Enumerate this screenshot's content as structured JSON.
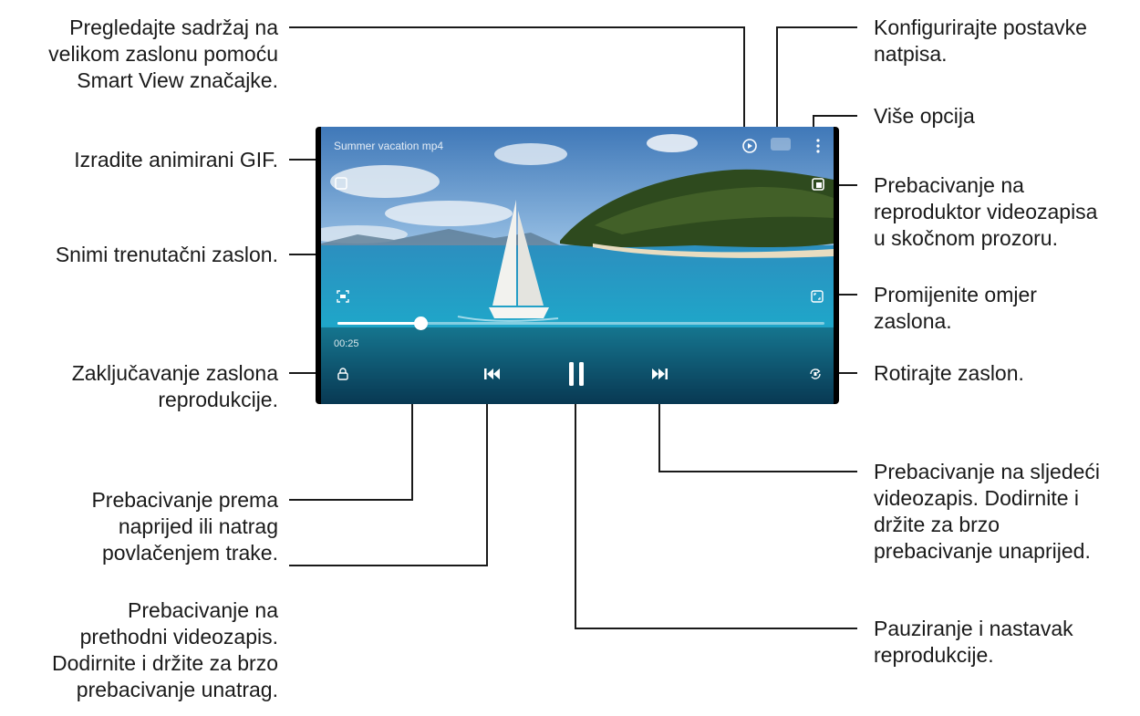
{
  "callouts": {
    "smart_view": [
      "Pregledajte sadržaj na",
      "velikom zaslonu pomoću",
      "Smart View značajke."
    ],
    "gif": [
      "Izradite animirani GIF."
    ],
    "capture": [
      "Snimi trenutačni zaslon."
    ],
    "lock": [
      "Zaključavanje zaslona",
      "reprodukcije."
    ],
    "seek": [
      "Prebacivanje prema",
      "naprijed ili natrag",
      "povlačenjem trake."
    ],
    "previous": [
      "Prebacivanje na",
      "prethodni videozapis.",
      "Dodirnite i držite za brzo",
      "prebacivanje unatrag."
    ],
    "subtitles": [
      "Konfigurirajte postavke",
      "natpisa."
    ],
    "more": [
      "Više opcija"
    ],
    "popup": [
      "Prebacivanje na",
      "reproduktor videozapisa",
      "u skočnom prozoru."
    ],
    "ratio": [
      "Promijenite omjer",
      "zaslona."
    ],
    "rotate": [
      "Rotirajte zaslon."
    ],
    "next": [
      "Prebacivanje na sljedeći",
      "videozapis. Dodirnite i",
      "držite za brzo",
      "prebacivanje unaprijed."
    ],
    "pause": [
      "Pauziranje i nastavak",
      "reprodukcije."
    ]
  },
  "player": {
    "video_title": "Summer vacation mp4",
    "elapsed_time": "00:25",
    "seek_progress": 0.17,
    "icons": [
      "smart-view-icon",
      "subtitle-icon",
      "more-options-icon",
      "gif-icon",
      "popup-player-icon",
      "capture-icon",
      "screen-ratio-icon",
      "lock-icon",
      "previous-icon",
      "pause-icon",
      "next-icon",
      "rotate-icon"
    ]
  },
  "colors": {
    "sky": "#6b9fd0",
    "sea": "#1f9fc4",
    "island": "#2e4a1e",
    "line": "#1a1a1a"
  }
}
